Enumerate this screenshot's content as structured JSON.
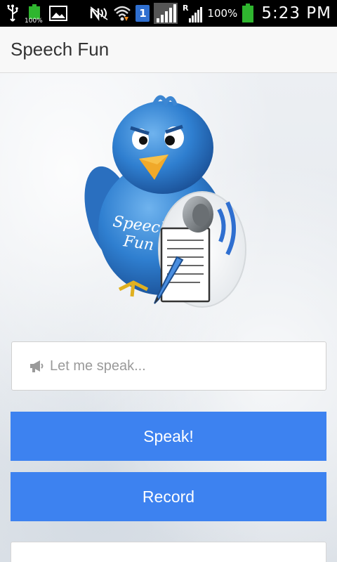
{
  "status_bar": {
    "left_icons": [
      "usb-icon",
      "battery-full-icon",
      "image-icon"
    ],
    "battery_small_label": "100%",
    "right_icons": [
      "nfc-icon",
      "wifi-icon",
      "signal-icon",
      "roaming-signal-icon",
      "battery-icon"
    ],
    "sim_number": "1",
    "roaming_label": "R",
    "battery_percent": "100%",
    "time": "5:23 PM"
  },
  "app": {
    "title": "Speech Fun"
  },
  "logo": {
    "text_line1": "Speech",
    "text_line2": "Fun"
  },
  "speak_input": {
    "placeholder": "Let me speak...",
    "value": "",
    "icon": "megaphone-icon"
  },
  "buttons": {
    "speak_label": "Speak!",
    "record_label": "Record"
  },
  "colors": {
    "primary_button": "#3d82f0",
    "action_bar": "#f8f8f8",
    "status_bar": "#000000"
  }
}
